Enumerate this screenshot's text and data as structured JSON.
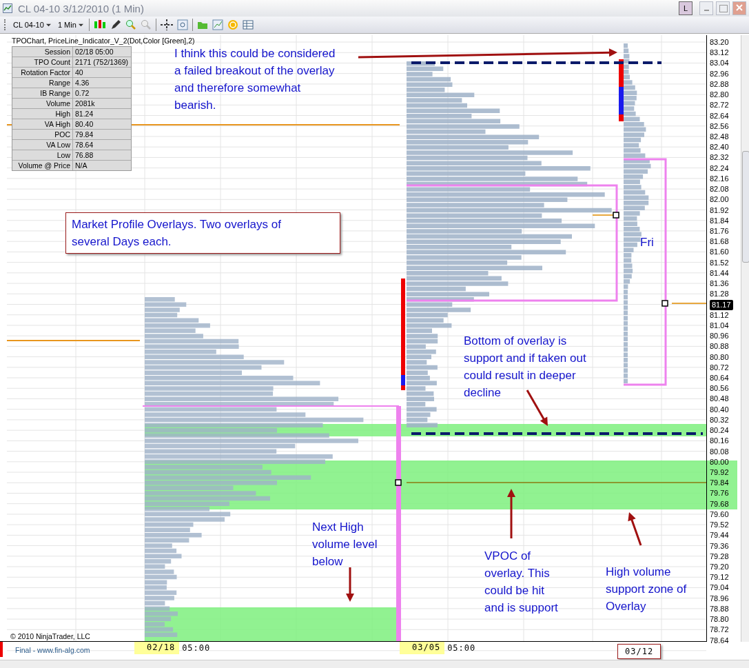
{
  "window": {
    "title": "CL 04-10  3/12/2010 (1 Min)",
    "buttons": [
      "L"
    ]
  },
  "toolbar": {
    "instrument": "CL 04-10",
    "interval": "1 Min"
  },
  "indicator_label": "TPOChart, PriceLine_Indicator_V_2(Dot,Color [Green],2)",
  "info_table": [
    {
      "label": "Session",
      "value": "02/18 05:00"
    },
    {
      "label": "TPO Count",
      "value": "2171 (752/1369)"
    },
    {
      "label": "Rotation Factor",
      "value": "40"
    },
    {
      "label": "Range",
      "value": "4.36"
    },
    {
      "label": "IB Range",
      "value": "0.72"
    },
    {
      "label": "Volume",
      "value": "2081k"
    },
    {
      "label": "High",
      "value": "81.24"
    },
    {
      "label": "VA High",
      "value": "80.40"
    },
    {
      "label": "POC",
      "value": "79.84"
    },
    {
      "label": "VA Low",
      "value": "78.64"
    },
    {
      "label": "Low",
      "value": "76.88"
    },
    {
      "label": "Volume @ Price",
      "value": "N/A"
    }
  ],
  "annotations": [
    {
      "kind": "note",
      "lines": [
        "I think this could be considered",
        "a failed breakout of the overlay",
        "and therefore somewhat",
        "bearish."
      ]
    },
    {
      "kind": "boxed",
      "lines": [
        "Market Profile Overlays.  Two overlays of",
        "several Days each."
      ]
    },
    {
      "kind": "note",
      "lines": [
        "Fri"
      ]
    },
    {
      "kind": "note",
      "lines": [
        "Bottom of overlay is",
        "support and if taken out",
        "could result in deeper",
        "decline"
      ]
    },
    {
      "kind": "note",
      "lines": [
        "Next High",
        "volume level",
        "below"
      ]
    },
    {
      "kind": "note",
      "lines": [
        "VPOC of",
        "overlay.  This",
        "could be hit",
        "and is support"
      ]
    },
    {
      "kind": "note",
      "lines": [
        "High volume",
        "support zone of",
        "Overlay"
      ]
    }
  ],
  "price_axis": [
    "83.20",
    "83.12",
    "83.04",
    "82.96",
    "82.88",
    "82.80",
    "82.72",
    "82.64",
    "82.56",
    "82.48",
    "82.40",
    "82.32",
    "82.24",
    "82.16",
    "82.08",
    "82.00",
    "81.92",
    "81.84",
    "81.76",
    "81.68",
    "81.60",
    "81.52",
    "81.44",
    "81.36",
    "81.28",
    "81.12",
    "81.04",
    "80.96",
    "80.88",
    "80.80",
    "80.72",
    "80.64",
    "80.56",
    "80.48",
    "80.40",
    "80.32",
    "80.24",
    "80.16",
    "80.08",
    "80.00",
    "79.92",
    "79.84",
    "79.76",
    "79.68",
    "79.60",
    "79.52",
    "79.44",
    "79.36",
    "79.28",
    "79.20",
    "79.12",
    "79.04",
    "78.96",
    "78.88",
    "78.80",
    "78.72",
    "78.64"
  ],
  "current_price": "81.17",
  "time_axis": [
    {
      "date": "02/18",
      "time": "05:00",
      "boxed": false
    },
    {
      "date": "03/05",
      "time": "05:00",
      "boxed": false
    },
    {
      "date": "03/12",
      "boxed": true
    }
  ],
  "copyright": "© 2010 NinjaTrader, LLC",
  "footer": "Final - www.fin-alg.com"
}
